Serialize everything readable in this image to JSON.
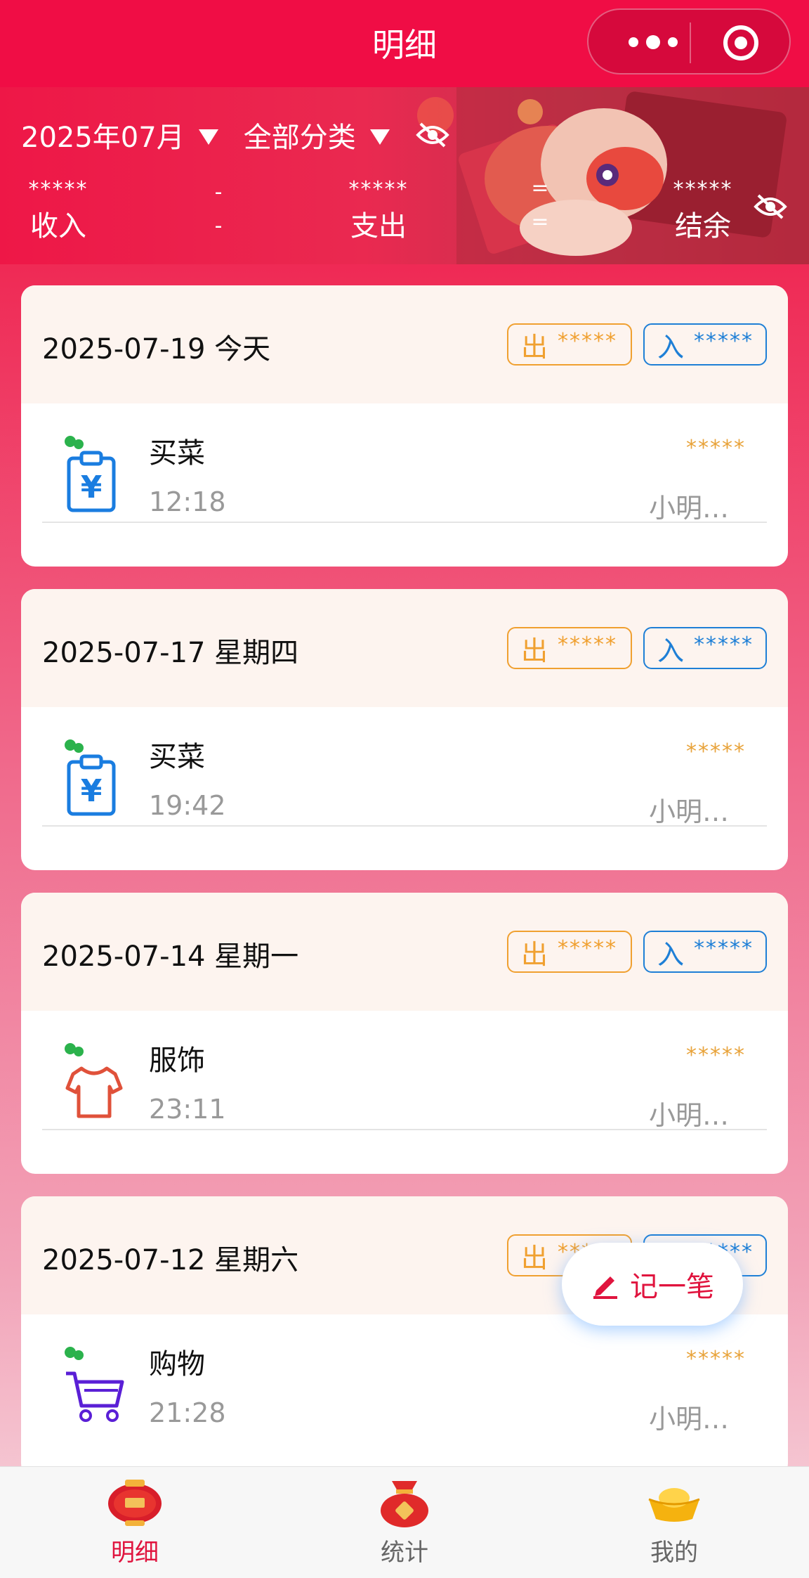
{
  "nav": {
    "title": "明细",
    "more_icon": "more-dots-icon",
    "close_icon": "target-icon"
  },
  "filters": {
    "month": "2025年07月",
    "category": "全部分类",
    "hide_icon": "eye-off-icon"
  },
  "summary": {
    "income": {
      "value": "*****",
      "label": "收入"
    },
    "minus_sign": "-",
    "expense": {
      "value": "*****",
      "label": "支出"
    },
    "equals_sign": "=",
    "balance": {
      "value": "*****",
      "label": "结余"
    }
  },
  "days": [
    {
      "date": "2025-07-19 今天",
      "out_label": "出",
      "out_value": "*****",
      "in_label": "入",
      "in_value": "*****",
      "item": {
        "name": "买菜",
        "time": "12:18",
        "amount": "*****",
        "who": "小明…",
        "icon": "clipboard-yen-icon"
      }
    },
    {
      "date": "2025-07-17 星期四",
      "out_label": "出",
      "out_value": "*****",
      "in_label": "入",
      "in_value": "*****",
      "item": {
        "name": "买菜",
        "time": "19:42",
        "amount": "*****",
        "who": "小明…",
        "icon": "clipboard-yen-icon"
      }
    },
    {
      "date": "2025-07-14 星期一",
      "out_label": "出",
      "out_value": "*****",
      "in_label": "入",
      "in_value": "*****",
      "item": {
        "name": "服饰",
        "time": "23:11",
        "amount": "*****",
        "who": "小明…",
        "icon": "tshirt-icon"
      }
    },
    {
      "date": "2025-07-12 星期六",
      "out_label": "出",
      "out_value": "*****",
      "in_label": "入",
      "in_value": "*****",
      "item": {
        "name": "购物",
        "time": "21:28",
        "amount": "*****",
        "who": "小明…",
        "icon": "shopping-cart-icon"
      }
    }
  ],
  "fab": {
    "label": "记一笔",
    "icon": "pencil-icon"
  },
  "tabs": [
    {
      "label": "明细",
      "icon": "red-lantern-icon",
      "active": true
    },
    {
      "label": "统计",
      "icon": "lucky-bag-icon",
      "active": false
    },
    {
      "label": "我的",
      "icon": "gold-ingot-icon",
      "active": false
    }
  ],
  "colors": {
    "primary": "#f00d45",
    "expense": "#f0a030",
    "income": "#1e7fd6",
    "amount": "#e8a33a"
  }
}
